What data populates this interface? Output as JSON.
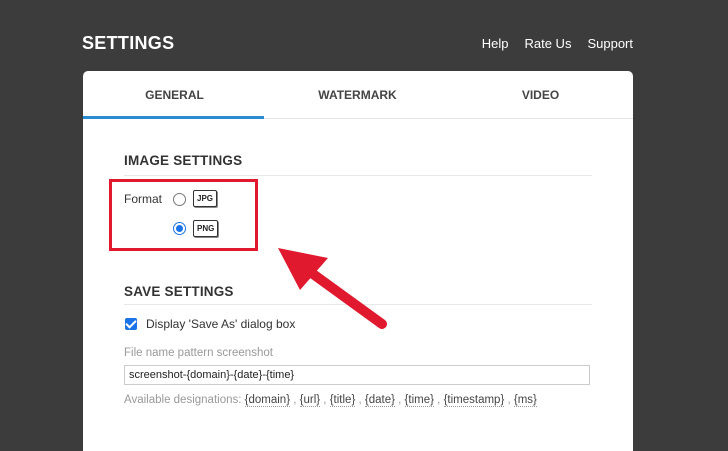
{
  "header": {
    "title": "SETTINGS",
    "links": [
      "Help",
      "Rate Us",
      "Support"
    ]
  },
  "tabs": [
    {
      "label": "GENERAL",
      "active": true
    },
    {
      "label": "WATERMARK",
      "active": false
    },
    {
      "label": "VIDEO",
      "active": false
    }
  ],
  "image_settings": {
    "title": "IMAGE SETTINGS",
    "format_label": "Format",
    "options": [
      {
        "label": "JPG",
        "selected": false
      },
      {
        "label": "PNG",
        "selected": true
      }
    ]
  },
  "save_settings": {
    "title": "SAVE SETTINGS",
    "save_as_label": "Display 'Save As' dialog box",
    "save_as_checked": true,
    "pattern_label": "File name pattern screenshot",
    "pattern_value": "screenshot-{domain}-{date}-{time}",
    "designations_label": "Available designations:",
    "designations": [
      "{domain}",
      "{url}",
      "{title}",
      "{date}",
      "{time}",
      "{timestamp}",
      "{ms}"
    ]
  },
  "colors": {
    "background": "#3c3c3c",
    "accent": "#2b8dd1",
    "highlight": "#e0192e",
    "checkbox": "#1a73e8"
  }
}
